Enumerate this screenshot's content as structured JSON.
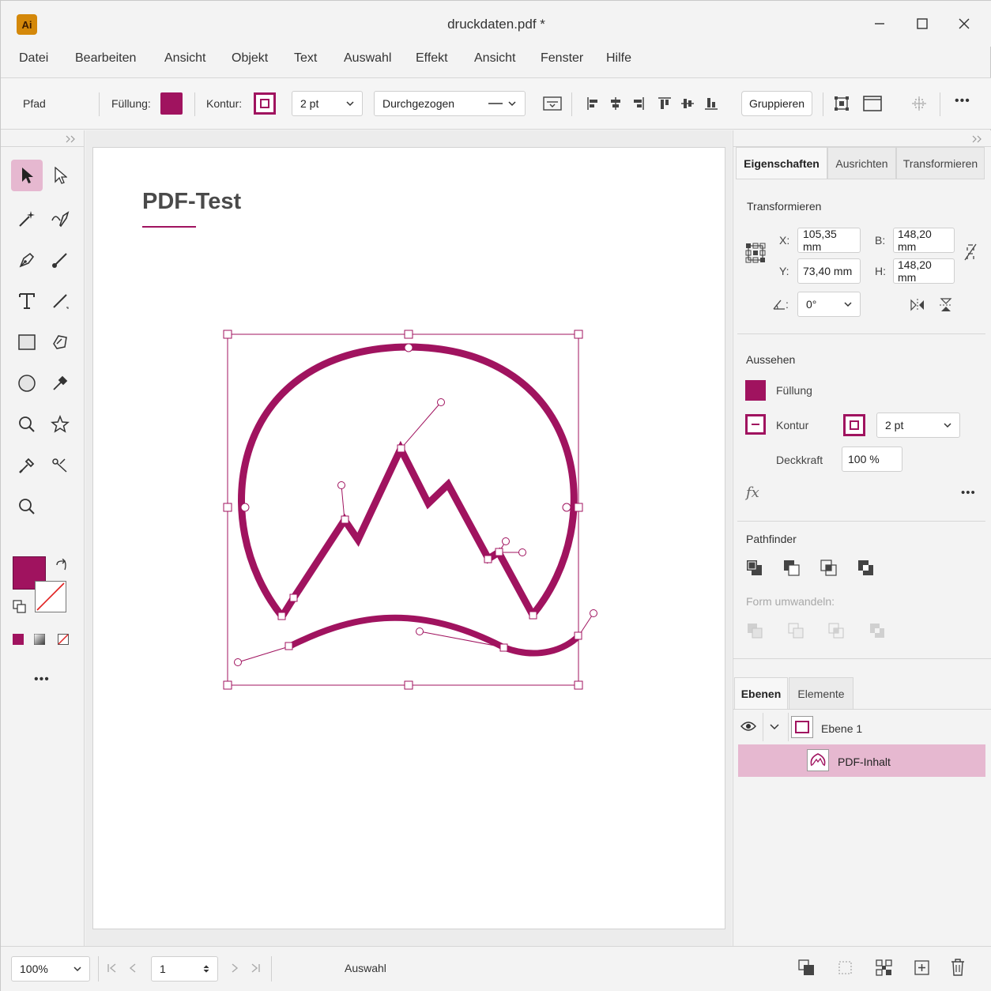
{
  "app": {
    "logo_text": "Ai",
    "title": "druckdaten.pdf *"
  },
  "window_controls": {
    "minimize": "—",
    "maximize": "☐",
    "close": "✕"
  },
  "menu": [
    "Datei",
    "Bearbeiten",
    "Ansicht",
    "Objekt",
    "Text",
    "Auswahl",
    "Effekt",
    "Ansicht",
    "Fenster",
    "Hilfe"
  ],
  "controlbar": {
    "object_type": "Pfad",
    "fill_label": "Füllung:",
    "stroke_label": "Kontur:",
    "stroke_weight": "2 pt",
    "stroke_style": "Durchgezogen",
    "group_button": "Gruppieren",
    "more": "•••"
  },
  "colors": {
    "accent": "#a0135f",
    "selection": "#e6b8d0"
  },
  "document": {
    "title": "PDF-Test"
  },
  "panel": {
    "tabs": [
      "Eigenschaften",
      "Ausrichten",
      "Transformieren"
    ],
    "transform": {
      "title": "Transformieren",
      "x_label": "X:",
      "x_value": "105,35 mm",
      "y_label": "Y:",
      "y_value": "73,40 mm",
      "w_label": "B:",
      "w_value": "148,20 mm",
      "h_label": "H:",
      "h_value": "148,20 mm",
      "angle_label": ":",
      "angle_value": "0°"
    },
    "appearance": {
      "title": "Aussehen",
      "fill_label": "Füllung",
      "stroke_label": "Kontur",
      "stroke_weight": "2 pt",
      "opacity_label": "Deckkraft",
      "opacity_value": "100 %",
      "fx": "fx",
      "more": "•••"
    },
    "pathfinder": {
      "title": "Pathfinder",
      "convert_label": "Form umwandeln:"
    },
    "layers": {
      "tabs": [
        "Ebenen",
        "Elemente"
      ],
      "layer_name": "Ebene 1",
      "item_name": "PDF-Inhalt"
    }
  },
  "toolbox": {
    "more": "•••"
  },
  "statusbar": {
    "zoom": "100%",
    "page": "1",
    "mode": "Auswahl"
  }
}
